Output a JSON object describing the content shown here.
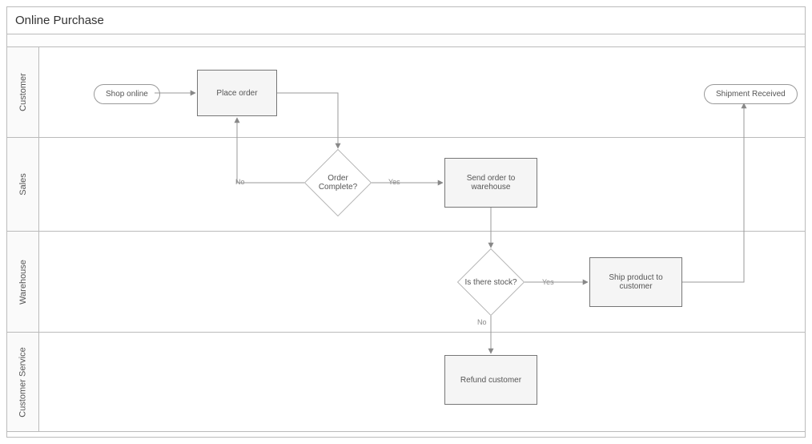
{
  "title": "Online Purchase",
  "lanes": {
    "customer": "Customer",
    "sales": "Sales",
    "warehouse": "Warehouse",
    "service": "Customer Service"
  },
  "nodes": {
    "shop_online": "Shop online",
    "place_order": "Place order",
    "order_complete": "Order Complete?",
    "send_order": "Send order to warehouse",
    "is_stock": "Is there stock?",
    "ship_product": "Ship product to customer",
    "shipment_received": "Shipment Received",
    "refund": "Refund customer"
  },
  "edges": {
    "yes1": "Yes",
    "no1": "No",
    "yes2": "Yes",
    "no2": "No"
  }
}
